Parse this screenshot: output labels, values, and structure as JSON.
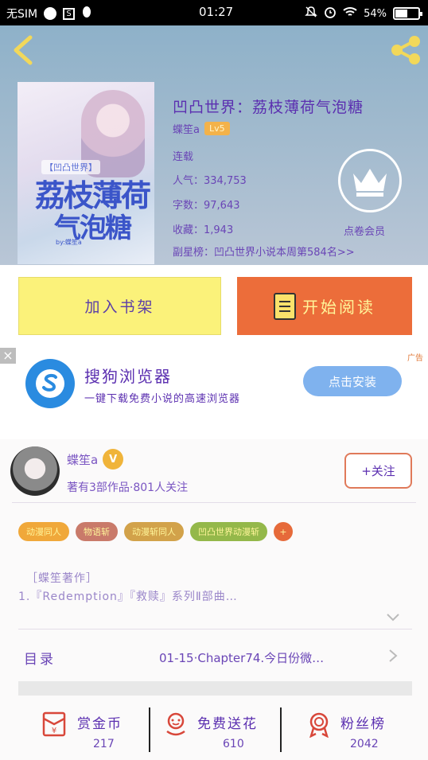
{
  "status_bar": {
    "carrier": "无SIM",
    "time": "01:27",
    "battery": "54%",
    "battery_level": 0.54
  },
  "book": {
    "title": "凹凸世界：荔枝薄荷气泡糖",
    "author": "蝶笙a",
    "level": "Lv5",
    "status": "连载",
    "popularity": "人气：334,753",
    "words": "字数：97,643",
    "favorites": "收藏：1,943",
    "rank": "副星榜：凹凸世界小说本周第584名>>",
    "vip_label": "点卷会员",
    "cover": {
      "series_tag": "【凹凸世界】",
      "title_line1": "荔枝薄荷",
      "title_line2": "气泡糖",
      "author": "by:蝶笙a"
    }
  },
  "actions": {
    "add_shelf": "加入书架",
    "start_reading": "开始阅读"
  },
  "ad": {
    "close": "×",
    "tag": "广告",
    "title": "搜狗浏览器",
    "description": "一键下载免费小说的高速浏览器",
    "install": "点击安装"
  },
  "author_card": {
    "name": "蝶笙a",
    "badge": "V",
    "stats": "著有3部作品·801人关注",
    "follow": "+关注"
  },
  "tags": [
    {
      "label": "动漫同人",
      "color": "#f0a83a"
    },
    {
      "label": "物语斩",
      "color": "#c97a6a"
    },
    {
      "label": "动漫斩同人",
      "color": "#d2a24a"
    },
    {
      "label": "凹凸世界动漫斩",
      "color": "#94b84a"
    },
    {
      "label": "+",
      "color": "#e66a3a"
    }
  ],
  "intro": {
    "heading": "［蝶笙著作］",
    "text": "1.『Redemption』『救赎』系列Ⅱ部曲…"
  },
  "toc": {
    "label": "目录",
    "latest": "01-15·Chapter74.今日份微…"
  },
  "bottom_stats": [
    {
      "label": "赏金币",
      "value": "217",
      "icon": "red-packet-icon"
    },
    {
      "label": "免费送花",
      "value": "610",
      "icon": "flower-icon"
    },
    {
      "label": "粉丝榜",
      "value": "2042",
      "icon": "medal-icon"
    }
  ],
  "colors": {
    "accent_purple": "#5b2fb0",
    "start_button": "#ec6d3a",
    "shelf_button": "#fbf27a",
    "install_button": "#7fb2ee"
  }
}
